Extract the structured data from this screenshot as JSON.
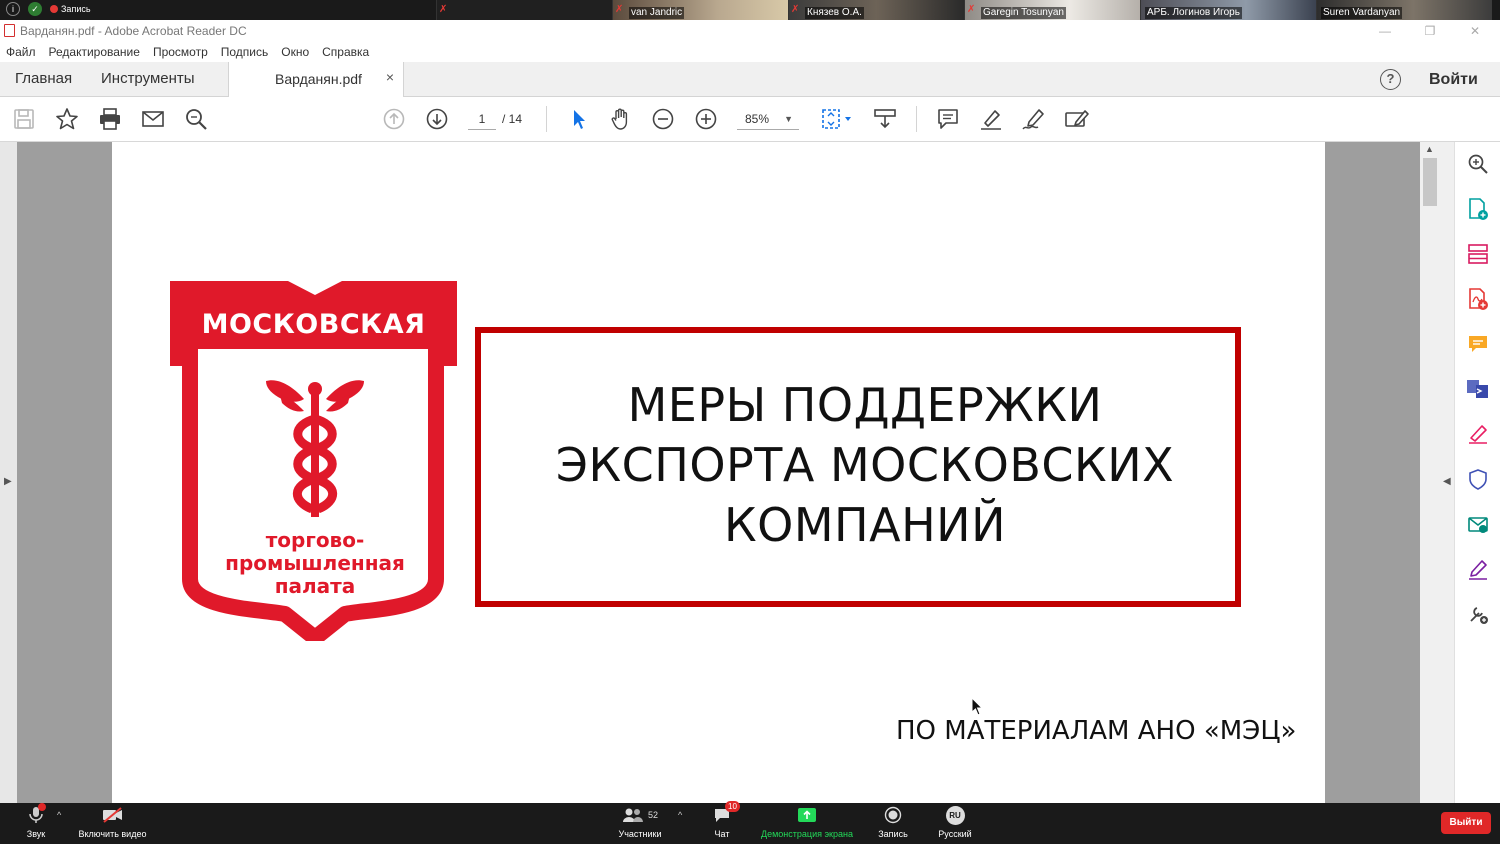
{
  "zoom_top": {
    "recording": "Запись",
    "participants": [
      {
        "name": ""
      },
      {
        "name": "van Jandric"
      },
      {
        "name": "Князев О.А."
      },
      {
        "name": "Garegin Tosunyan"
      },
      {
        "name": "АРБ. Логинов Игорь"
      },
      {
        "name": "Suren Vardanyan"
      }
    ]
  },
  "window": {
    "title": "Варданян.pdf - Adobe Acrobat Reader DC"
  },
  "menu": [
    "Файл",
    "Редактирование",
    "Просмотр",
    "Подпись",
    "Окно",
    "Справка"
  ],
  "tabs": {
    "home": "Главная",
    "tools": "Инструменты",
    "document": "Варданян.pdf",
    "close": "×",
    "signin": "Войти",
    "help": "?"
  },
  "toolbar": {
    "page_current": "1",
    "page_total": "/ 14",
    "zoom": "85%"
  },
  "document": {
    "logo_top": "МОСКОВСКАЯ",
    "logo_bottom": [
      "торгово-",
      "промышленная",
      "палата"
    ],
    "headline": [
      "МЕРЫ ПОДДЕРЖКИ",
      "ЭКСПОРТА МОСКОВСКИХ",
      "КОМПАНИЙ"
    ],
    "footnote": "ПО МАТЕРИАЛАМ АНО «МЭЦ»"
  },
  "zoom_bottom": {
    "audio": "Звук",
    "video": "Включить видео",
    "participants": "Участники",
    "participants_count": "52",
    "chat": "Чат",
    "chat_badge": "10",
    "share": "Демонстрация экрана",
    "record": "Запись",
    "language": "Русский",
    "language_code": "RU",
    "leave": "Выйти"
  },
  "colors": {
    "accent_red": "#c00000",
    "acrobat_blue": "#1473e6",
    "zoom_green": "#23d959"
  }
}
